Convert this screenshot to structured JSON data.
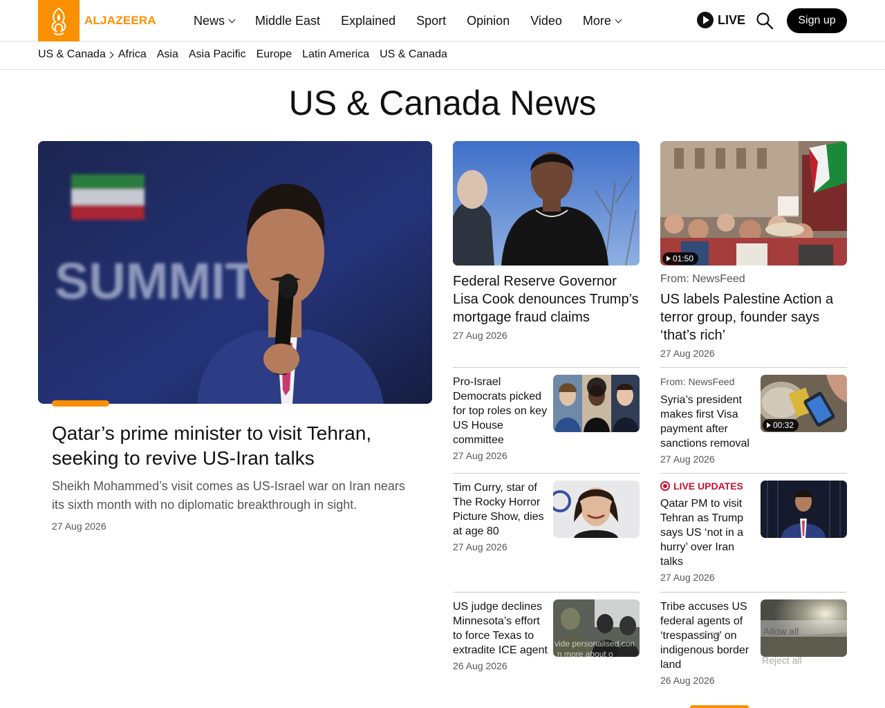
{
  "brand": {
    "name": "ALJAZEERA",
    "accent": "#fa9000"
  },
  "nav": {
    "items": [
      {
        "label": "News",
        "dropdown": true
      },
      {
        "label": "Middle East",
        "dropdown": false
      },
      {
        "label": "Explained",
        "dropdown": false
      },
      {
        "label": "Sport",
        "dropdown": false
      },
      {
        "label": "Opinion",
        "dropdown": false
      },
      {
        "label": "Video",
        "dropdown": false
      },
      {
        "label": "More",
        "dropdown": true
      }
    ],
    "live": "LIVE",
    "signup": "Sign up"
  },
  "subnav": {
    "current": "US & Canada",
    "items": [
      "Africa",
      "Asia",
      "Asia Pacific",
      "Europe",
      "Latin America",
      "US & Canada"
    ]
  },
  "page_title": "US & Canada News",
  "hero": {
    "title": "Qatar’s prime minister to visit Tehran, seeking to revive US-Iran talks",
    "summary": "Sheikh Mohammed’s visit comes as US-Israel war on Iran nears its sixth month with no diplomatic breakthrough in sight.",
    "date": "27 Aug 2026",
    "image_text": "SUMMIT"
  },
  "col2_top": {
    "title": "Federal Reserve Governor Lisa Cook denounces Trump’s mortgage fraud claims",
    "date": "27 Aug 2026"
  },
  "col3_top": {
    "from": "From: NewsFeed",
    "title": "US labels Palestine Action a terror group, founder says ‘that’s rich’",
    "date": "27 Aug 2026",
    "duration": "01:50"
  },
  "col2_list": [
    {
      "title": "Pro-Israel Democrats picked for top roles on key US House committee",
      "date": "27 Aug 2026"
    },
    {
      "title": "Tim Curry, star of The Rocky Horror Picture Show, dies at age 80",
      "date": "27 Aug 2026"
    },
    {
      "title": "US judge declines Minnesota’s effort to force Texas to extradite ICE agent",
      "date": "26 Aug 2026"
    }
  ],
  "col3_list": [
    {
      "from": "From: NewsFeed",
      "title": "Syria’s president makes first Visa payment after sanctions removal",
      "date": "27 Aug 2026",
      "duration": "00:32"
    },
    {
      "badge": "LIVE UPDATES",
      "title": "Qatar PM to visit Tehran as Trump says US ‘not in a hurry’ over Iran talks",
      "date": "27 Aug 2026"
    },
    {
      "title": "Tribe accuses US federal agents of ‘trespassing’ on indigenous border land",
      "date": "26 Aug 2026"
    }
  ],
  "cookie_overlay": {
    "allow": "Allow all",
    "reject": "Reject all",
    "text": "vide personalised con",
    "text2": "n more about o"
  }
}
